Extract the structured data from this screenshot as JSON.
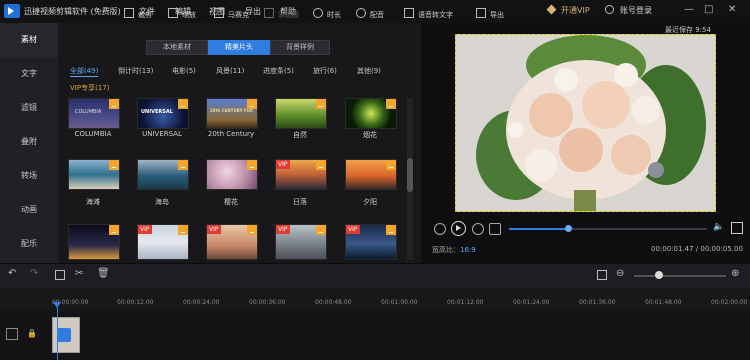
{
  "app": {
    "title": "迅捷视频剪辑软件 (免费版)"
  },
  "menu": [
    "文件",
    "编辑",
    "视图",
    "导出",
    "帮助"
  ],
  "account": {
    "vip": "开通VIP",
    "login": "账号登录"
  },
  "window_controls": {
    "minimize": "—",
    "maximize": "□",
    "close": "✕"
  },
  "sidebar": {
    "items": [
      "素材",
      "文字",
      "滤镜",
      "叠附",
      "转场",
      "动画",
      "配乐"
    ]
  },
  "library": {
    "tabs": [
      "本地素材",
      "精美片头",
      "背景样例"
    ],
    "categories": [
      "全部(49)",
      "倒计时(13)",
      "电影(5)",
      "风景(11)",
      "进度条(5)",
      "旅行(6)",
      "其他(9)"
    ],
    "vip_exclusive": "VIP专享(17)",
    "vip_badge": "VIP",
    "thumbnails": [
      {
        "label": "COLUMBIA",
        "thumb_text": "COLUMBIA"
      },
      {
        "label": "UNIVERSAL",
        "thumb_text": "UNIVERSAL"
      },
      {
        "label": "20th Century",
        "thumb_text": "20th CENTURY FOX"
      },
      {
        "label": "自然",
        "thumb_text": ""
      },
      {
        "label": "烟花",
        "thumb_text": ""
      },
      {
        "label": "海滩",
        "thumb_text": ""
      },
      {
        "label": "海岛",
        "thumb_text": ""
      },
      {
        "label": "樱花",
        "thumb_text": ""
      },
      {
        "label": "日落",
        "thumb_text": ""
      },
      {
        "label": "夕阳",
        "thumb_text": ""
      },
      {
        "label": "",
        "thumb_text": ""
      },
      {
        "label": "",
        "thumb_text": ""
      },
      {
        "label": "",
        "thumb_text": ""
      },
      {
        "label": "",
        "thumb_text": ""
      },
      {
        "label": "",
        "thumb_text": ""
      }
    ]
  },
  "preview": {
    "saved": "最近保存 9:54",
    "aspect_label": "宽高比：",
    "aspect_value": "16:9",
    "timecode": "00:00:01.47 / 00:00:05.00",
    "progress": 0.3
  },
  "toolbar": [
    "裁剪",
    "缩放",
    "马赛克",
    "添加帧",
    "时长",
    "配音",
    "语音转文字",
    "导出"
  ],
  "ruler": [
    "00:00:00.00",
    "00:00:12.00",
    "00:00:24.00",
    "00:00:36.00",
    "00:00:48.00",
    "00:01:00.00",
    "00:01:12.00",
    "00:01:24.00",
    "00:01:36.00",
    "00:01:48.00",
    "00:02:00.00"
  ]
}
